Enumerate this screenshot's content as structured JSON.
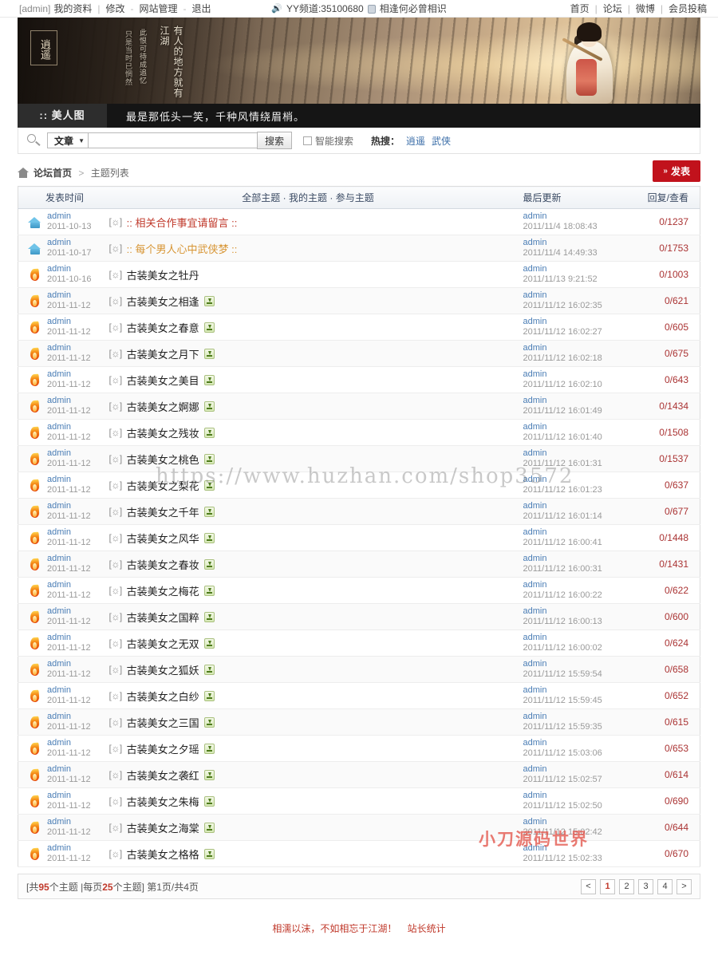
{
  "topbar": {
    "user_tag": "[admin]",
    "profile": "我的资料",
    "sep1": "|",
    "edit": "修改",
    "dash1": "-",
    "site_admin": "网站管理",
    "dash2": "-",
    "logout": "退出",
    "yy_channel": "YY频道:35100680",
    "slogan": "相逢何必曾相识",
    "nav": [
      {
        "label": "首页"
      },
      {
        "label": "论坛"
      },
      {
        "label": "微博"
      },
      {
        "label": "会员投稿"
      }
    ]
  },
  "banner": {
    "seal_text": "逍遥",
    "line1": "有人的地方就有江湖",
    "line2": "此恨可待成追忆",
    "line3": "只是当时已惘然"
  },
  "blackbar": {
    "category": ":: 美人图",
    "slogan": "最是那低头一笑，千种风情绕眉梢。"
  },
  "search": {
    "scope": "文章",
    "caret": "▼",
    "value": "",
    "placeholder": "",
    "button": "搜索",
    "smart_label": "智能搜索",
    "hot_label": "热搜：",
    "hot_tags": [
      "逍遥",
      "武侠"
    ]
  },
  "breadcrumb": {
    "home": "论坛首页",
    "sep": ">",
    "current": "主题列表",
    "post_button": "发表",
    "post_button_chevron": "»"
  },
  "table": {
    "headers": {
      "time": "发表时间",
      "filters": [
        "全部主题",
        "我的主题",
        "参与主题"
      ],
      "filter_sep": "·",
      "updated": "最后更新",
      "counts": "回复/查看"
    },
    "rows": [
      {
        "icon": "house-icon",
        "author": "admin",
        "date": "2011-10-13",
        "prefix": "[☼]",
        "title": ":: 相关合作事宜请留言 ::",
        "color": "red",
        "attach": false,
        "upd_author": "admin",
        "upd_time": "2011/11/4 18:08:43",
        "counts": "0/1237"
      },
      {
        "icon": "house-icon",
        "author": "admin",
        "date": "2011-10-17",
        "prefix": "[☼]",
        "title": ":: 每个男人心中武侠梦 ::",
        "color": "orange",
        "attach": false,
        "upd_author": "admin",
        "upd_time": "2011/11/4 14:49:33",
        "counts": "0/1753"
      },
      {
        "icon": "flame-icon",
        "author": "admin",
        "date": "2011-10-16",
        "prefix": "[☼]",
        "title": "古装美女之牡丹",
        "color": "plain",
        "attach": false,
        "upd_author": "admin",
        "upd_time": "2011/11/13 9:21:52",
        "counts": "0/1003"
      },
      {
        "icon": "flame-icon",
        "author": "admin",
        "date": "2011-11-12",
        "prefix": "[☼]",
        "title": "古装美女之相逢",
        "color": "plain",
        "attach": true,
        "upd_author": "admin",
        "upd_time": "2011/11/12 16:02:35",
        "counts": "0/621"
      },
      {
        "icon": "flame-icon",
        "author": "admin",
        "date": "2011-11-12",
        "prefix": "[☼]",
        "title": "古装美女之春意",
        "color": "plain",
        "attach": true,
        "upd_author": "admin",
        "upd_time": "2011/11/12 16:02:27",
        "counts": "0/605"
      },
      {
        "icon": "flame-icon",
        "author": "admin",
        "date": "2011-11-12",
        "prefix": "[☼]",
        "title": "古装美女之月下",
        "color": "plain",
        "attach": true,
        "upd_author": "admin",
        "upd_time": "2011/11/12 16:02:18",
        "counts": "0/675"
      },
      {
        "icon": "flame-icon",
        "author": "admin",
        "date": "2011-11-12",
        "prefix": "[☼]",
        "title": "古装美女之美目",
        "color": "plain",
        "attach": true,
        "upd_author": "admin",
        "upd_time": "2011/11/12 16:02:10",
        "counts": "0/643"
      },
      {
        "icon": "flame-icon",
        "author": "admin",
        "date": "2011-11-12",
        "prefix": "[☼]",
        "title": "古装美女之婀娜",
        "color": "plain",
        "attach": true,
        "upd_author": "admin",
        "upd_time": "2011/11/12 16:01:49",
        "counts": "0/1434"
      },
      {
        "icon": "flame-icon",
        "author": "admin",
        "date": "2011-11-12",
        "prefix": "[☼]",
        "title": "古装美女之残妆",
        "color": "plain",
        "attach": true,
        "upd_author": "admin",
        "upd_time": "2011/11/12 16:01:40",
        "counts": "0/1508"
      },
      {
        "icon": "flame-icon",
        "author": "admin",
        "date": "2011-11-12",
        "prefix": "[☼]",
        "title": "古装美女之桃色",
        "color": "plain",
        "attach": true,
        "upd_author": "admin",
        "upd_time": "2011/11/12 16:01:31",
        "counts": "0/1537"
      },
      {
        "icon": "flame-icon",
        "author": "admin",
        "date": "2011-11-12",
        "prefix": "[☼]",
        "title": "古装美女之梨花",
        "color": "plain",
        "attach": true,
        "upd_author": "admin",
        "upd_time": "2011/11/12 16:01:23",
        "counts": "0/637"
      },
      {
        "icon": "flame-icon",
        "author": "admin",
        "date": "2011-11-12",
        "prefix": "[☼]",
        "title": "古装美女之千年",
        "color": "plain",
        "attach": true,
        "upd_author": "admin",
        "upd_time": "2011/11/12 16:01:14",
        "counts": "0/677"
      },
      {
        "icon": "flame-icon",
        "author": "admin",
        "date": "2011-11-12",
        "prefix": "[☼]",
        "title": "古装美女之风华",
        "color": "plain",
        "attach": true,
        "upd_author": "admin",
        "upd_time": "2011/11/12 16:00:41",
        "counts": "0/1448"
      },
      {
        "icon": "flame-icon",
        "author": "admin",
        "date": "2011-11-12",
        "prefix": "[☼]",
        "title": "古装美女之春妆",
        "color": "plain",
        "attach": true,
        "upd_author": "admin",
        "upd_time": "2011/11/12 16:00:31",
        "counts": "0/1431"
      },
      {
        "icon": "flame-icon",
        "author": "admin",
        "date": "2011-11-12",
        "prefix": "[☼]",
        "title": "古装美女之梅花",
        "color": "plain",
        "attach": true,
        "upd_author": "admin",
        "upd_time": "2011/11/12 16:00:22",
        "counts": "0/622"
      },
      {
        "icon": "flame-icon",
        "author": "admin",
        "date": "2011-11-12",
        "prefix": "[☼]",
        "title": "古装美女之国粹",
        "color": "plain",
        "attach": true,
        "upd_author": "admin",
        "upd_time": "2011/11/12 16:00:13",
        "counts": "0/600"
      },
      {
        "icon": "flame-icon",
        "author": "admin",
        "date": "2011-11-12",
        "prefix": "[☼]",
        "title": "古装美女之无双",
        "color": "plain",
        "attach": true,
        "upd_author": "admin",
        "upd_time": "2011/11/12 16:00:02",
        "counts": "0/624"
      },
      {
        "icon": "flame-icon",
        "author": "admin",
        "date": "2011-11-12",
        "prefix": "[☼]",
        "title": "古装美女之狐妖",
        "color": "plain",
        "attach": true,
        "upd_author": "admin",
        "upd_time": "2011/11/12 15:59:54",
        "counts": "0/658"
      },
      {
        "icon": "flame-icon",
        "author": "admin",
        "date": "2011-11-12",
        "prefix": "[☼]",
        "title": "古装美女之白纱",
        "color": "plain",
        "attach": true,
        "upd_author": "admin",
        "upd_time": "2011/11/12 15:59:45",
        "counts": "0/652"
      },
      {
        "icon": "flame-icon",
        "author": "admin",
        "date": "2011-11-12",
        "prefix": "[☼]",
        "title": "古装美女之三国",
        "color": "plain",
        "attach": true,
        "upd_author": "admin",
        "upd_time": "2011/11/12 15:59:35",
        "counts": "0/615"
      },
      {
        "icon": "flame-icon",
        "author": "admin",
        "date": "2011-11-12",
        "prefix": "[☼]",
        "title": "古装美女之夕瑶",
        "color": "plain",
        "attach": true,
        "upd_author": "admin",
        "upd_time": "2011/11/12 15:03:06",
        "counts": "0/653"
      },
      {
        "icon": "flame-icon",
        "author": "admin",
        "date": "2011-11-12",
        "prefix": "[☼]",
        "title": "古装美女之袭红",
        "color": "plain",
        "attach": true,
        "upd_author": "admin",
        "upd_time": "2011/11/12 15:02:57",
        "counts": "0/614"
      },
      {
        "icon": "flame-icon",
        "author": "admin",
        "date": "2011-11-12",
        "prefix": "[☼]",
        "title": "古装美女之朱梅",
        "color": "plain",
        "attach": true,
        "upd_author": "admin",
        "upd_time": "2011/11/12 15:02:50",
        "counts": "0/690"
      },
      {
        "icon": "flame-icon",
        "author": "admin",
        "date": "2011-11-12",
        "prefix": "[☼]",
        "title": "古装美女之海棠",
        "color": "plain",
        "attach": true,
        "upd_author": "admin",
        "upd_time": "2011/11/12 15:02:42",
        "counts": "0/644"
      },
      {
        "icon": "flame-icon",
        "author": "admin",
        "date": "2011-11-12",
        "prefix": "[☼]",
        "title": "古装美女之格格",
        "color": "plain",
        "attach": true,
        "upd_author": "admin",
        "upd_time": "2011/11/12 15:02:33",
        "counts": "0/670"
      }
    ]
  },
  "pager": {
    "total_prefix": "[共",
    "total_count": "95",
    "total_suffix": "个主题",
    "divider": "|",
    "perpage_prefix": "每页",
    "perpage_count": "25",
    "perpage_suffix": "个主题]",
    "page_info": "第1页/共4页",
    "buttons": [
      "<",
      "1",
      "2",
      "3",
      "4",
      ">"
    ],
    "current": "1"
  },
  "footer": {
    "slogan": "相濡以沫，不如相忘于江湖！",
    "stats": "站长统计"
  },
  "watermarks": {
    "url": "https://www.huzhan.com/shop3572",
    "brand": "小刀源码世界"
  }
}
